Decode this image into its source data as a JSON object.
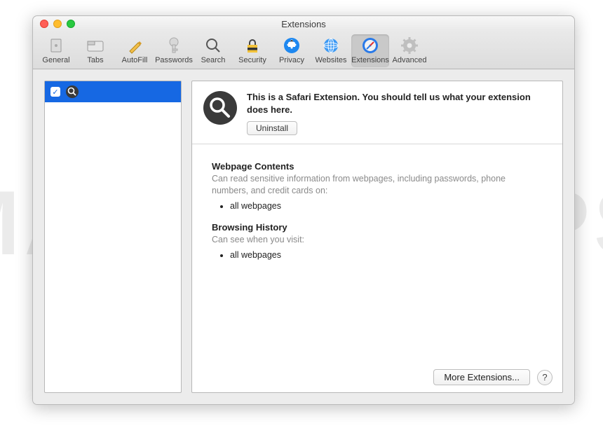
{
  "window_title": "Extensions",
  "toolbar": [
    {
      "id": "general",
      "label": "General"
    },
    {
      "id": "tabs",
      "label": "Tabs"
    },
    {
      "id": "autofill",
      "label": "AutoFill"
    },
    {
      "id": "passwords",
      "label": "Passwords"
    },
    {
      "id": "search",
      "label": "Search"
    },
    {
      "id": "security",
      "label": "Security"
    },
    {
      "id": "privacy",
      "label": "Privacy"
    },
    {
      "id": "websites",
      "label": "Websites"
    },
    {
      "id": "extensions",
      "label": "Extensions",
      "selected": true
    },
    {
      "id": "advanced",
      "label": "Advanced"
    }
  ],
  "sidebar": {
    "items": [
      {
        "checked": true,
        "name": ""
      }
    ]
  },
  "detail": {
    "description": "This is a Safari Extension. You should tell us what your extension does here.",
    "uninstall_label": "Uninstall",
    "permissions": {
      "webpage_contents": {
        "title": "Webpage Contents",
        "subtitle": "Can read sensitive information from webpages, including passwords, phone numbers, and credit cards on:",
        "items": [
          "all webpages"
        ]
      },
      "browsing_history": {
        "title": "Browsing History",
        "subtitle": "Can see when you visit:",
        "items": [
          "all webpages"
        ]
      }
    }
  },
  "footer": {
    "more_extensions_label": "More Extensions...",
    "help_label": "?"
  },
  "watermark": "MALWARETIPS"
}
